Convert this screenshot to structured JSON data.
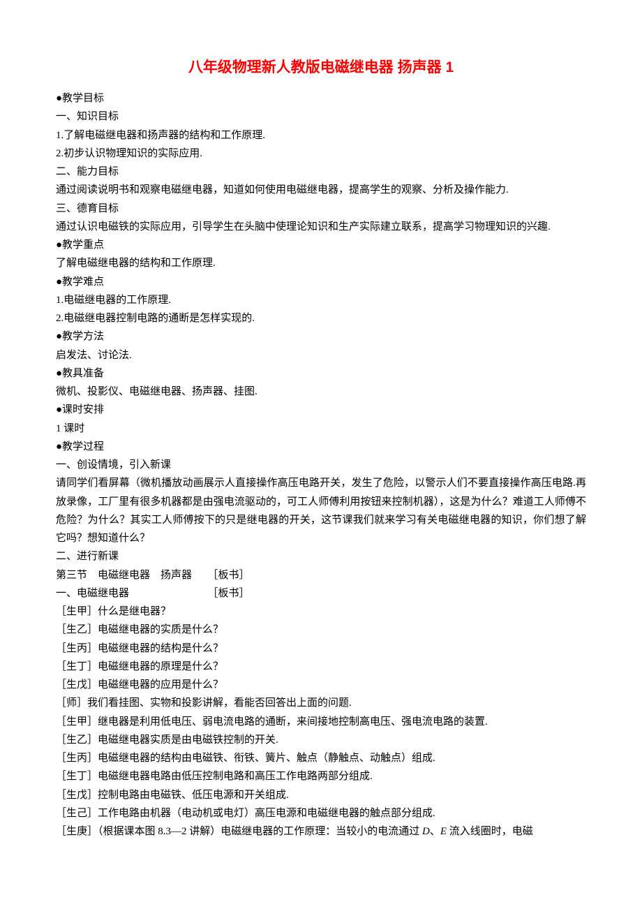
{
  "title": "八年级物理新人教版电磁继电器 扬声器 1",
  "lines": [
    "●教学目标",
    "一、知识目标",
    "1.了解电磁继电器和扬声器的结构和工作原理.",
    "2.初步认识物理知识的实际应用.",
    "二、能力目标",
    "通过阅读说明书和观察电磁继电器，知道如何使用电磁继电器，提高学生的观察、分析及操作能力.",
    "三、德育目标",
    "通过认识电磁铁的实际应用，引导学生在头脑中使理论知识和生产实际建立联系，提高学习物理知识的兴趣.",
    "●教学重点",
    "了解电磁继电器的结构和工作原理.",
    "●教学难点",
    "1.电磁继电器的工作原理.",
    "2.电磁继电器控制电路的通断是怎样实现的.",
    "●教学方法",
    "启发法、讨论法.",
    "●教具准备",
    "微机、投影仪、电磁继电器、扬声器、挂图.",
    "●课时安排",
    "1 课时",
    "●教学过程",
    "一、创设情境，引入新课",
    "请同学们看屏幕（微机播放动画展示人直接操作高压电路开关，发生了危险，以警示人们不要直接操作高压电路.再放录像，工厂里有很多机器都是由强电流驱动的，可工人师傅利用按钮来控制机器），这是为什么？难道工人师傅不危险？为什么？其实工人师傅按下的只是继电器的开关，这节课我们就来学习有关电磁继电器的知识，你们想了解它吗？想知道什么？",
    "二、进行新课",
    "第三节　电磁继电器　扬声器　　［板书］",
    "一、电磁继电器　　　　　　　　［板书］",
    "［生甲］什么是继电器？",
    "［生乙］电磁继电器的实质是什么？",
    "［生丙］电磁继电器的结构是什么？",
    "［生丁］电磁继电器的原理是什么？",
    "［生戊］电磁继电器的应用是什么？",
    "［师］我们看挂图、实物和投影讲解，看能否回答出上面的问题.",
    "［生甲］继电器是利用低电压、弱电流电路的通断，来间接地控制高电压、强电流电路的装置.",
    "［生乙］电磁继电器实质是由电磁铁控制的开关.",
    "［生丙］电磁继电器的结构由电磁铁、衔铁、簧片、触点（静触点、动触点）组成.",
    "［生丁］电磁继电器电路由低压控制电路和高压工作电路两部分组成.",
    "［生戊］控制电路由电磁铁、低压电源和开关组成.",
    "［生己］工作电路由机器（电动机或电灯）高压电源和电磁继电器的触点部分组成."
  ],
  "last_line": {
    "prefix": "［生庚］（根据课本图 8.3—2 讲解）电磁继电器的工作原理：当较小的电流通过 ",
    "d": "D",
    "sep": "、",
    "e": "E",
    "suffix": " 流入线圈时，电磁"
  }
}
